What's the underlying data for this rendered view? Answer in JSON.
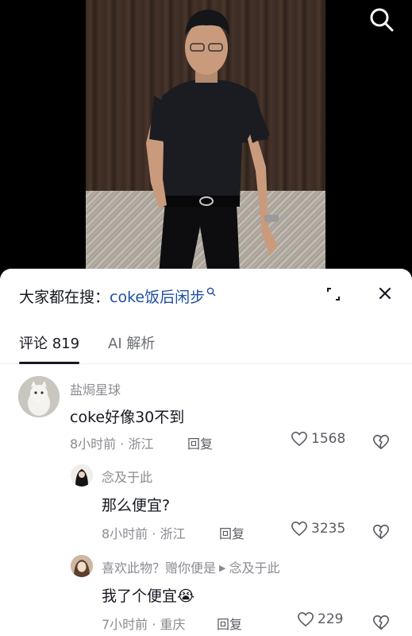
{
  "header": {
    "hot_search_prefix": "大家都在搜：",
    "hot_search_keyword": "coke饭后闲步",
    "hot_search_icon": "search-mini-icon"
  },
  "tabs": [
    {
      "label": "评论 819",
      "active": true
    },
    {
      "label": "AI 解析",
      "active": false
    }
  ],
  "comments": [
    {
      "username": "盐焗星球",
      "text": "coke好像30不到",
      "meta": "8小时前 · 浙江",
      "reply_label": "回复",
      "likes": "1568"
    },
    {
      "username": "念及于此",
      "text": "那么便宜?",
      "meta": "8小时前 · 浙江",
      "reply_label": "回复",
      "likes": "3235"
    },
    {
      "username": "喜欢此物？赠你便是",
      "reply_to": "念及于此",
      "text": "我了个便宜",
      "emoji": "😭",
      "meta": "7小时前 · 重庆",
      "reply_label": "回复",
      "likes": "229"
    }
  ],
  "colors": {
    "keyword": "#1f4fa3",
    "text_primary": "#161823",
    "text_secondary": "#8a8b91"
  }
}
